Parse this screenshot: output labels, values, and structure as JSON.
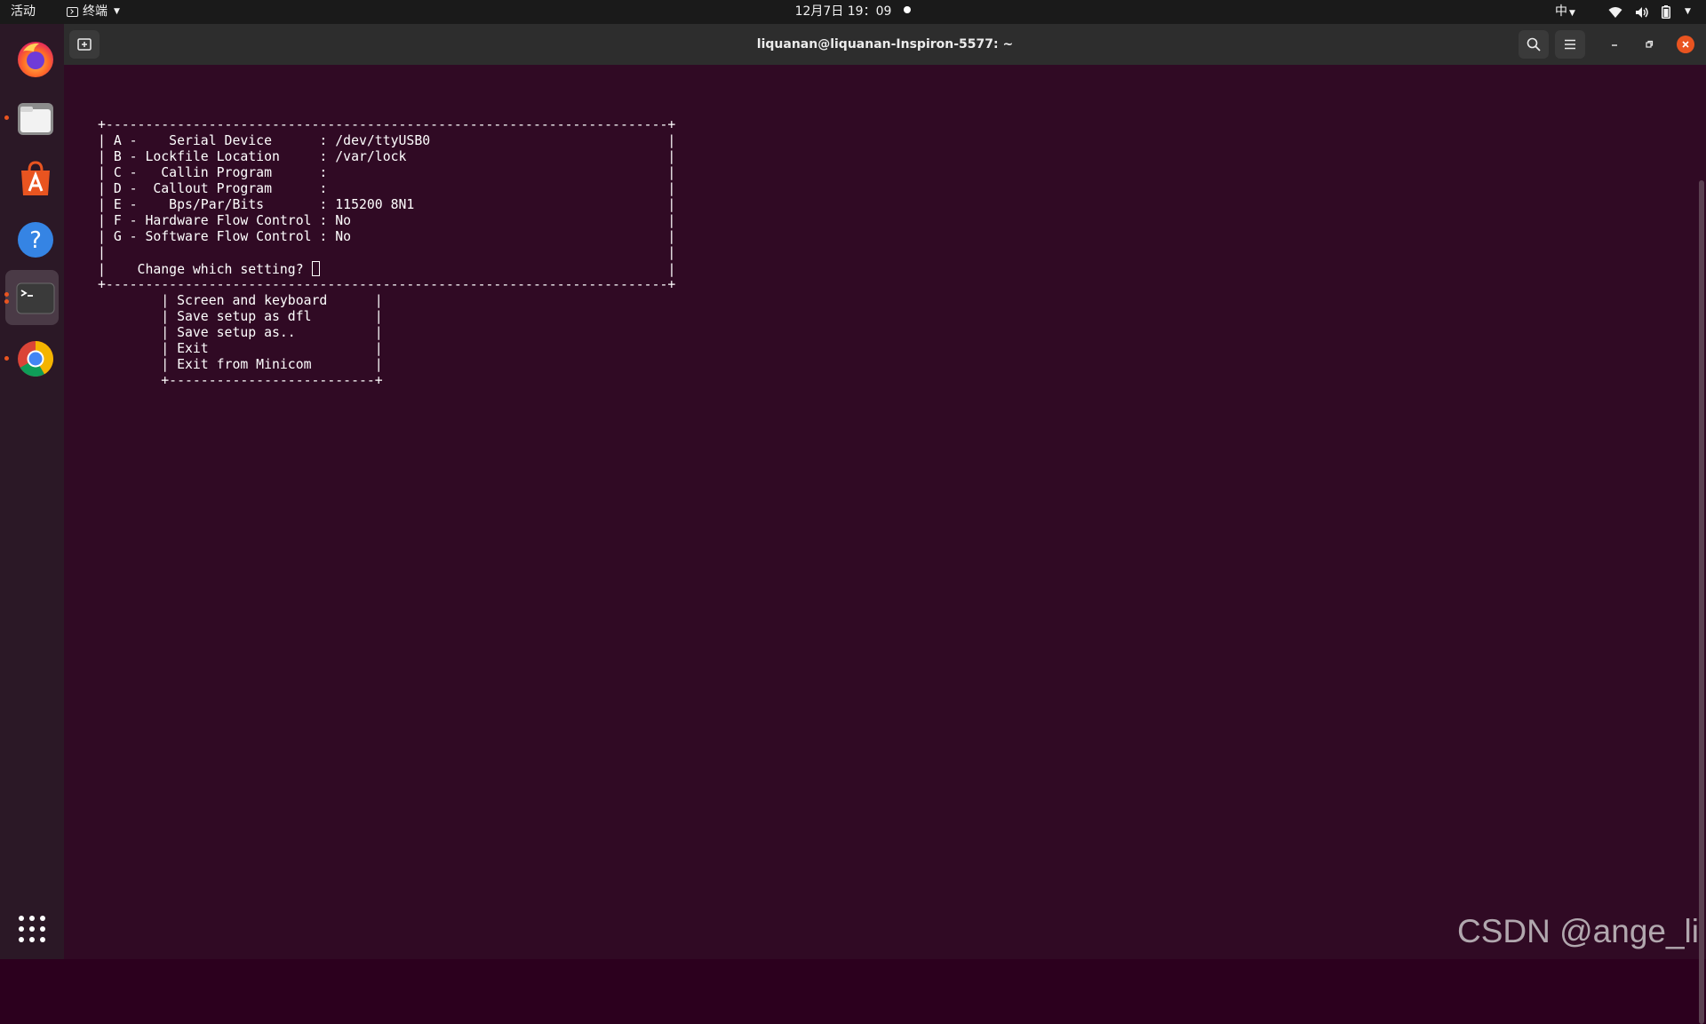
{
  "topbar": {
    "activities": "活动",
    "app_menu": "终端",
    "clock": "12月7日  19：09",
    "input_method": "中"
  },
  "dock": {
    "items": [
      {
        "name": "firefox",
        "running": false
      },
      {
        "name": "files",
        "running": true
      },
      {
        "name": "software",
        "running": false
      },
      {
        "name": "help",
        "running": false
      },
      {
        "name": "terminal",
        "running": true,
        "active": true
      },
      {
        "name": "chrome",
        "running": true
      }
    ]
  },
  "window": {
    "title": "liquanan@liquanan-Inspiron-5577: ~"
  },
  "terminal": {
    "lines": [
      "+-----------------------------------------------------------------------+",
      "| A -    Serial Device      : /dev/ttyUSB0                              |",
      "| B - Lockfile Location     : /var/lock                                 |",
      "| C -   Callin Program      :                                           |",
      "| D -  Callout Program      :                                           |",
      "| E -    Bps/Par/Bits       : 115200 8N1                                |",
      "| F - Hardware Flow Control : No                                        |",
      "| G - Software Flow Control : No                                        |",
      "|                                                                       |",
      "|    Change which setting? ",
      "+-----------------------------------------------------------------------+",
      "        | Screen and keyboard      |",
      "        | Save setup as dfl        |",
      "        | Save setup as..          |",
      "        | Exit                     |",
      "        | Exit from Minicom        |",
      "        +--------------------------+"
    ],
    "prompt_tail": "                                            |"
  },
  "watermark": "CSDN @ange_li",
  "colors": {
    "terminal_bg": "#300a24",
    "accent": "#e95420",
    "topbar_bg": "#1a1a1a",
    "headerbar_bg": "#2d2d2d"
  }
}
